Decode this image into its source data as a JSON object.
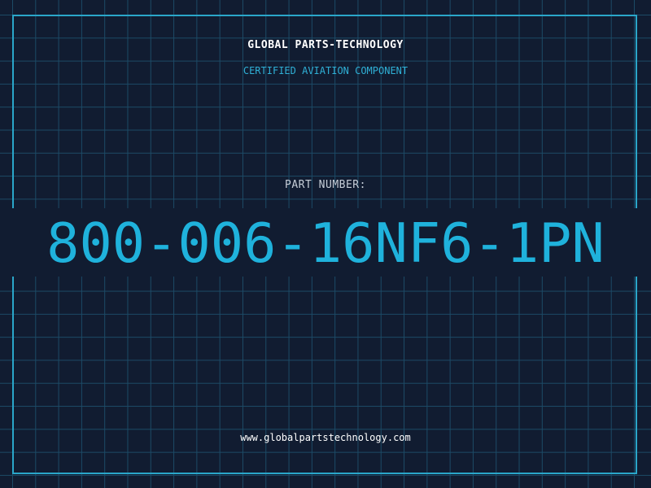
{
  "header": {
    "brand": "GLOBAL PARTS-TECHNOLOGY",
    "subtitle": "CERTIFIED AVIATION COMPONENT"
  },
  "part": {
    "label": "PART NUMBER:",
    "number": "800-006-16NF6-1PN"
  },
  "footer": {
    "url": "www.globalpartstechnology.com"
  },
  "colors": {
    "background": "#111c31",
    "grid": "#1c4a66",
    "accent": "#1fb2dc",
    "text": "#ffffff",
    "muted": "#c6ced8"
  }
}
